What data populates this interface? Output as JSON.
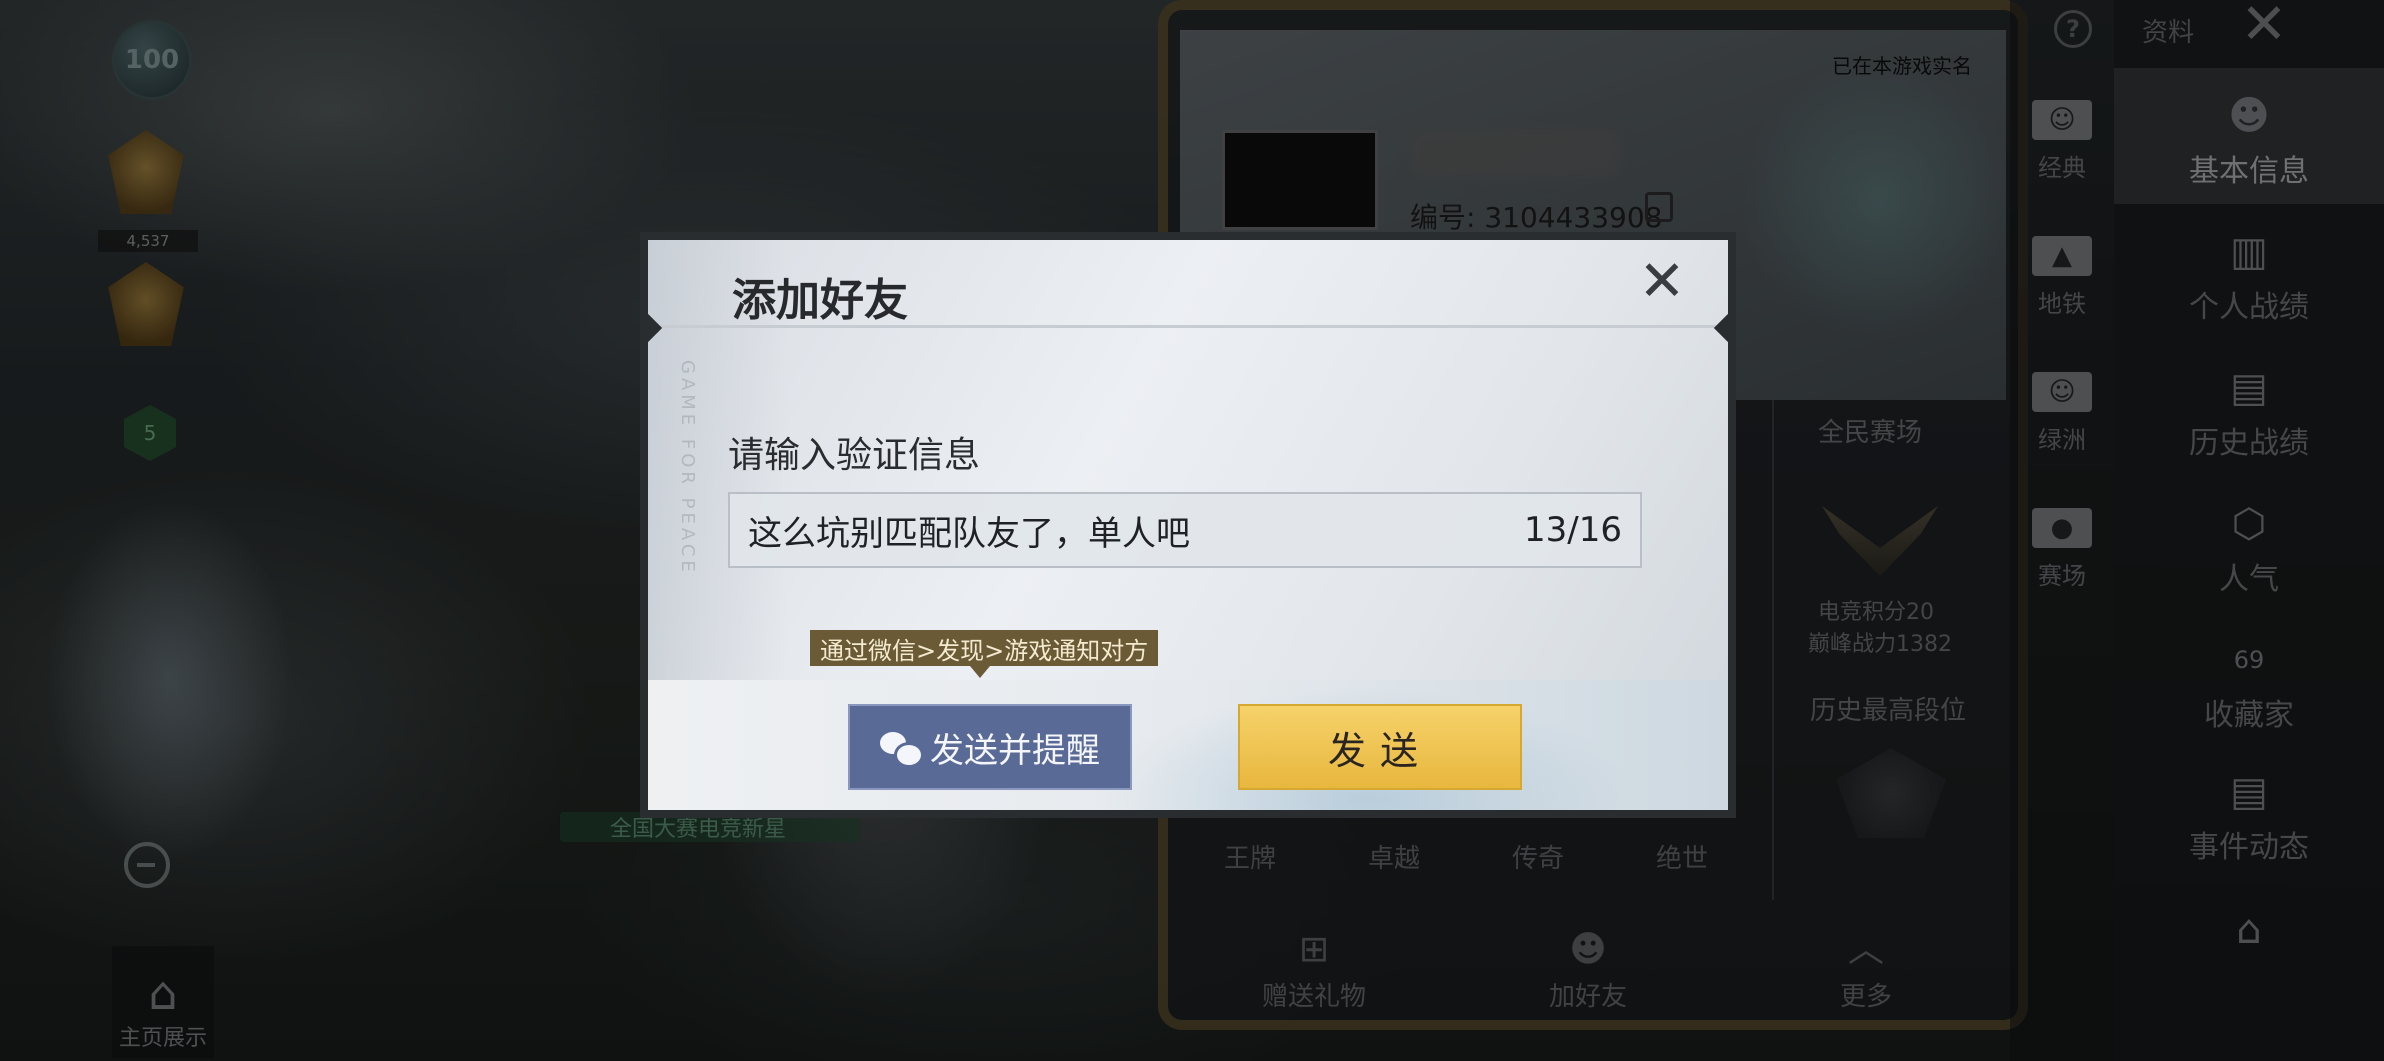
{
  "background": {
    "level": "100",
    "rank_score": "4,537",
    "shield_level": "5",
    "event_banner": "全国大赛电竞新星",
    "home_display_label": "主页展示"
  },
  "profile": {
    "real_name_note": "已在本游戏实名",
    "player_id": "编号: 3104433908",
    "section_national": "全民赛场",
    "esports_score": "电竞积分20",
    "peak_power": "巅峰战力1382",
    "highest_tier_label": "历史最高段位",
    "tiers": [
      "王牌",
      "卓越",
      "传奇",
      "绝世"
    ],
    "actions": [
      {
        "label": "赠送礼物",
        "icon": "gift-icon"
      },
      {
        "label": "加好友",
        "icon": "add-friend-icon"
      },
      {
        "label": "更多",
        "icon": "chevron-up-icon"
      }
    ]
  },
  "top_bar": {
    "profile_label": "资料"
  },
  "mode_rail": [
    {
      "label": "经典",
      "icon": "classic-icon",
      "glyph": "☺"
    },
    {
      "label": "地铁",
      "icon": "metro-icon",
      "glyph": "▲"
    },
    {
      "label": "绿洲",
      "icon": "oasis-icon",
      "glyph": "☺"
    },
    {
      "label": "赛场",
      "icon": "arena-icon",
      "glyph": "●"
    }
  ],
  "info_rail": [
    {
      "label": "基本信息",
      "icon": "basic-info-icon",
      "glyph": "☻"
    },
    {
      "label": "个人战绩",
      "icon": "stats-icon",
      "glyph": "▥"
    },
    {
      "label": "历史战绩",
      "icon": "history-icon",
      "glyph": "▤"
    },
    {
      "label": "人气",
      "icon": "popularity-icon",
      "glyph": "⬡"
    },
    {
      "label": "收藏家",
      "icon": "collector-icon",
      "glyph": "69"
    },
    {
      "label": "事件动态",
      "icon": "events-icon",
      "glyph": "▤"
    },
    {
      "label": "",
      "icon": "home-card-icon",
      "glyph": "⌂"
    }
  ],
  "dialog": {
    "title": "添加好友",
    "prompt": "请输入验证信息",
    "message": "这么坑别匹配队友了，单人吧",
    "char_count": "13/16",
    "tooltip": "通过微信>发现>游戏通知对方",
    "send_remind_label": "发送并提醒",
    "send_label": "发送",
    "watermark": "GAME FOR PEACE"
  }
}
